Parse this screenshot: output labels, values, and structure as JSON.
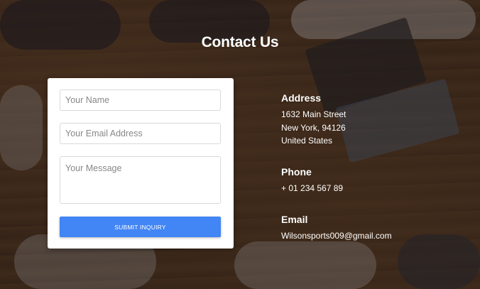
{
  "page": {
    "title": "Contact Us"
  },
  "form": {
    "name_placeholder": "Your Name",
    "email_placeholder": "Your Email Address",
    "message_placeholder": "Your Message",
    "submit_label": "SUBMIT INQUIRY"
  },
  "info": {
    "address": {
      "heading": "Address",
      "lines": [
        "1632 Main Street",
        "New York, 94126",
        "United States"
      ]
    },
    "phone": {
      "heading": "Phone",
      "value": "+ 01 234 567 89"
    },
    "email": {
      "heading": "Email",
      "value": "Wilsonsports009@gmail.com"
    }
  },
  "colors": {
    "accent": "#4285f4",
    "card": "#ffffff",
    "text_light": "#ffffff"
  }
}
